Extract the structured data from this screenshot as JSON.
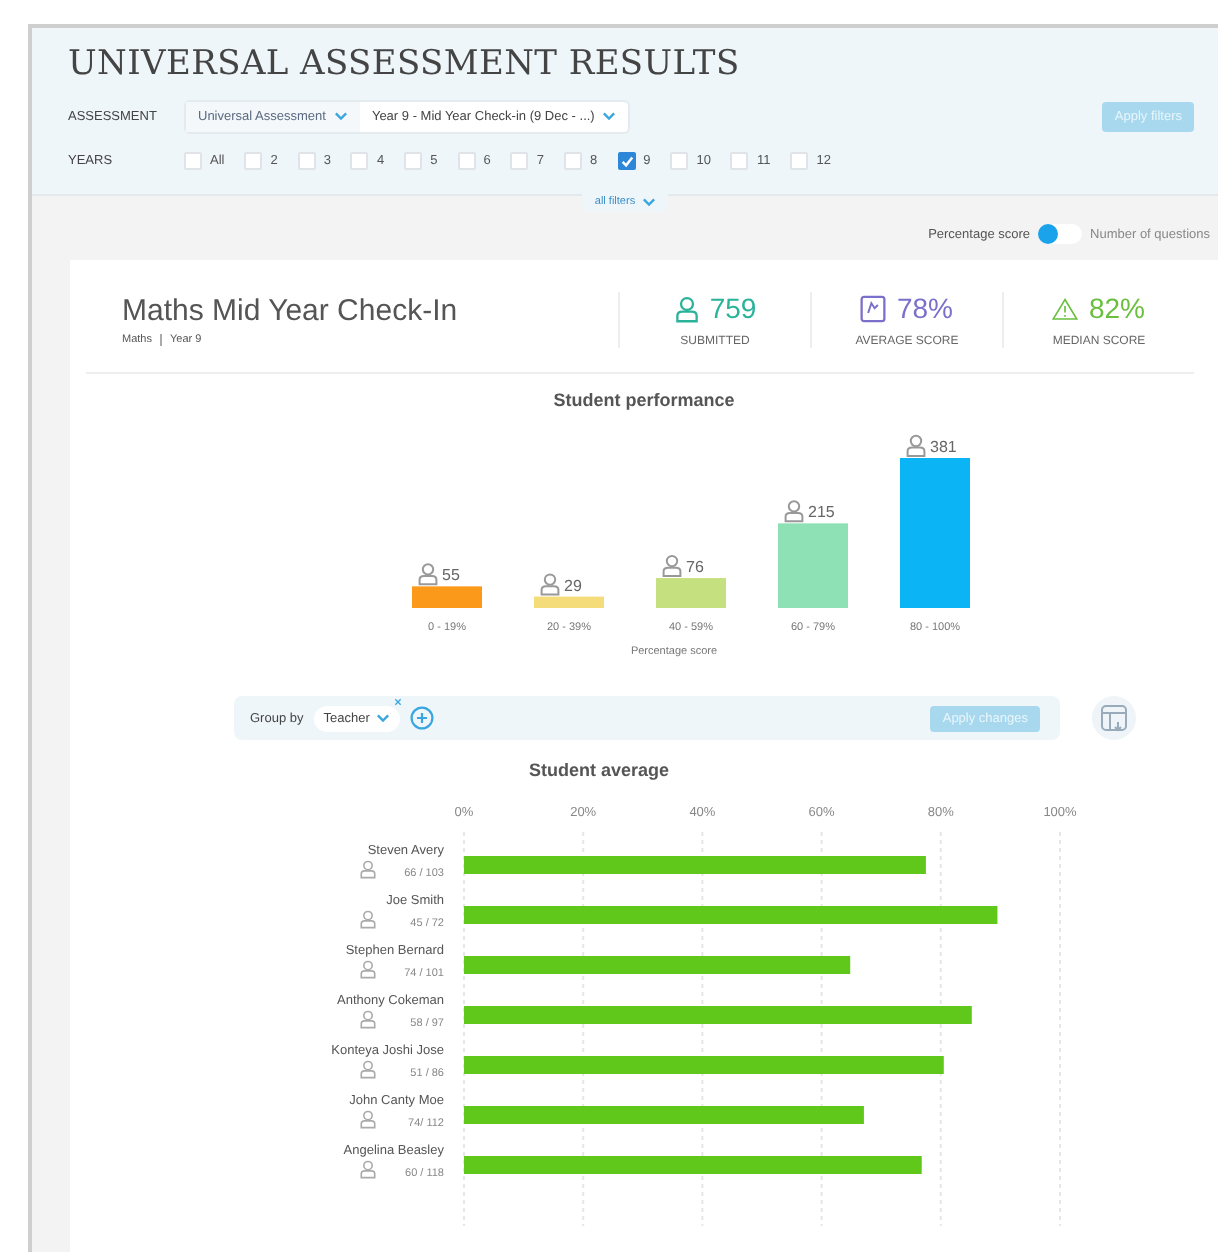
{
  "title": "UNIVERSAL ASSESSMENT RESULTS",
  "filters": {
    "assessment_label": "ASSESSMENT",
    "assessment_type": "Universal Assessment",
    "assessment": "Year 9 -  Mid Year Check-in (9 Dec - ...)",
    "years_label": "YEARS",
    "years": [
      {
        "label": "All",
        "checked": false
      },
      {
        "label": "2",
        "checked": false
      },
      {
        "label": "3",
        "checked": false
      },
      {
        "label": "4",
        "checked": false
      },
      {
        "label": "5",
        "checked": false
      },
      {
        "label": "6",
        "checked": false
      },
      {
        "label": "7",
        "checked": false
      },
      {
        "label": "8",
        "checked": false
      },
      {
        "label": "9",
        "checked": true
      },
      {
        "label": "10",
        "checked": false
      },
      {
        "label": "11",
        "checked": false
      },
      {
        "label": "12",
        "checked": false
      }
    ],
    "apply_button": "Apply filters",
    "all_filters": "all filters"
  },
  "score_toggle": {
    "options": [
      {
        "label": "Percentage score",
        "selected": true
      },
      {
        "label": "Number of questions",
        "selected": false
      }
    ]
  },
  "summary": {
    "name": "Maths Mid Year Check-In",
    "subject": "Maths",
    "year": "Year 9",
    "stats": [
      {
        "kind": "submitted",
        "value": "759",
        "label": "SUBMITTED",
        "color": "#2bb39a"
      },
      {
        "kind": "average",
        "value": "78%",
        "label": "AVERAGE SCORE",
        "color": "#7a6fca"
      },
      {
        "kind": "median",
        "value": "82%",
        "label": "MEDIAN SCORE",
        "color": "#6abf3f"
      }
    ]
  },
  "performance": {
    "chart_data": {
      "type": "bar",
      "title": "Student performance",
      "xlabel": "Percentage score",
      "categories": [
        "0 - 19%",
        "20 - 39%",
        "40 - 59%",
        "60 - 79%",
        "80 - 100%"
      ],
      "series": [
        {
          "values": [
            55,
            29,
            76,
            215,
            381
          ]
        }
      ],
      "data_labels": true
    },
    "bars": [
      {
        "color": "#fb9a1a"
      },
      {
        "color": "#f5dc7a"
      },
      {
        "color": "#c5e07e"
      },
      {
        "color": "#8ee0b5"
      },
      {
        "color": "#0bb4f5"
      }
    ]
  },
  "grouping": {
    "label": "Group by",
    "group": "Teacher",
    "apply_button": "Apply changes"
  },
  "average": {
    "chart_data": {
      "type": "bar",
      "orientation": "horizontal",
      "title": "Student average",
      "categories": [
        "Steven Avery",
        "Joe Smith",
        "Stephen Bernard",
        "Anthony Cokeman",
        "Konteya Joshi Jose",
        "John Canty Moe",
        "Angelina Beasley"
      ],
      "grid": true,
      "series": [
        {
          "color": "#5fc81a",
          "values": [
            0.775,
            0.895,
            0.648,
            0.852,
            0.805,
            0.671,
            0.768
          ]
        }
      ],
      "xlim": [
        0,
        1
      ],
      "xticks": [
        {
          "value": 0,
          "label": "0%"
        },
        {
          "value": 0.2,
          "label": "20%"
        },
        {
          "value": 0.4,
          "label": "40%"
        },
        {
          "value": 0.6,
          "label": "60%"
        },
        {
          "value": 0.8,
          "label": "80%"
        },
        {
          "value": 1,
          "label": "100%"
        }
      ]
    },
    "counts": [
      "66 / 103",
      "45 / 72",
      "74 / 101",
      "58 / 97",
      "51 / 86",
      "74/ 112",
      "60 / 118"
    ]
  }
}
